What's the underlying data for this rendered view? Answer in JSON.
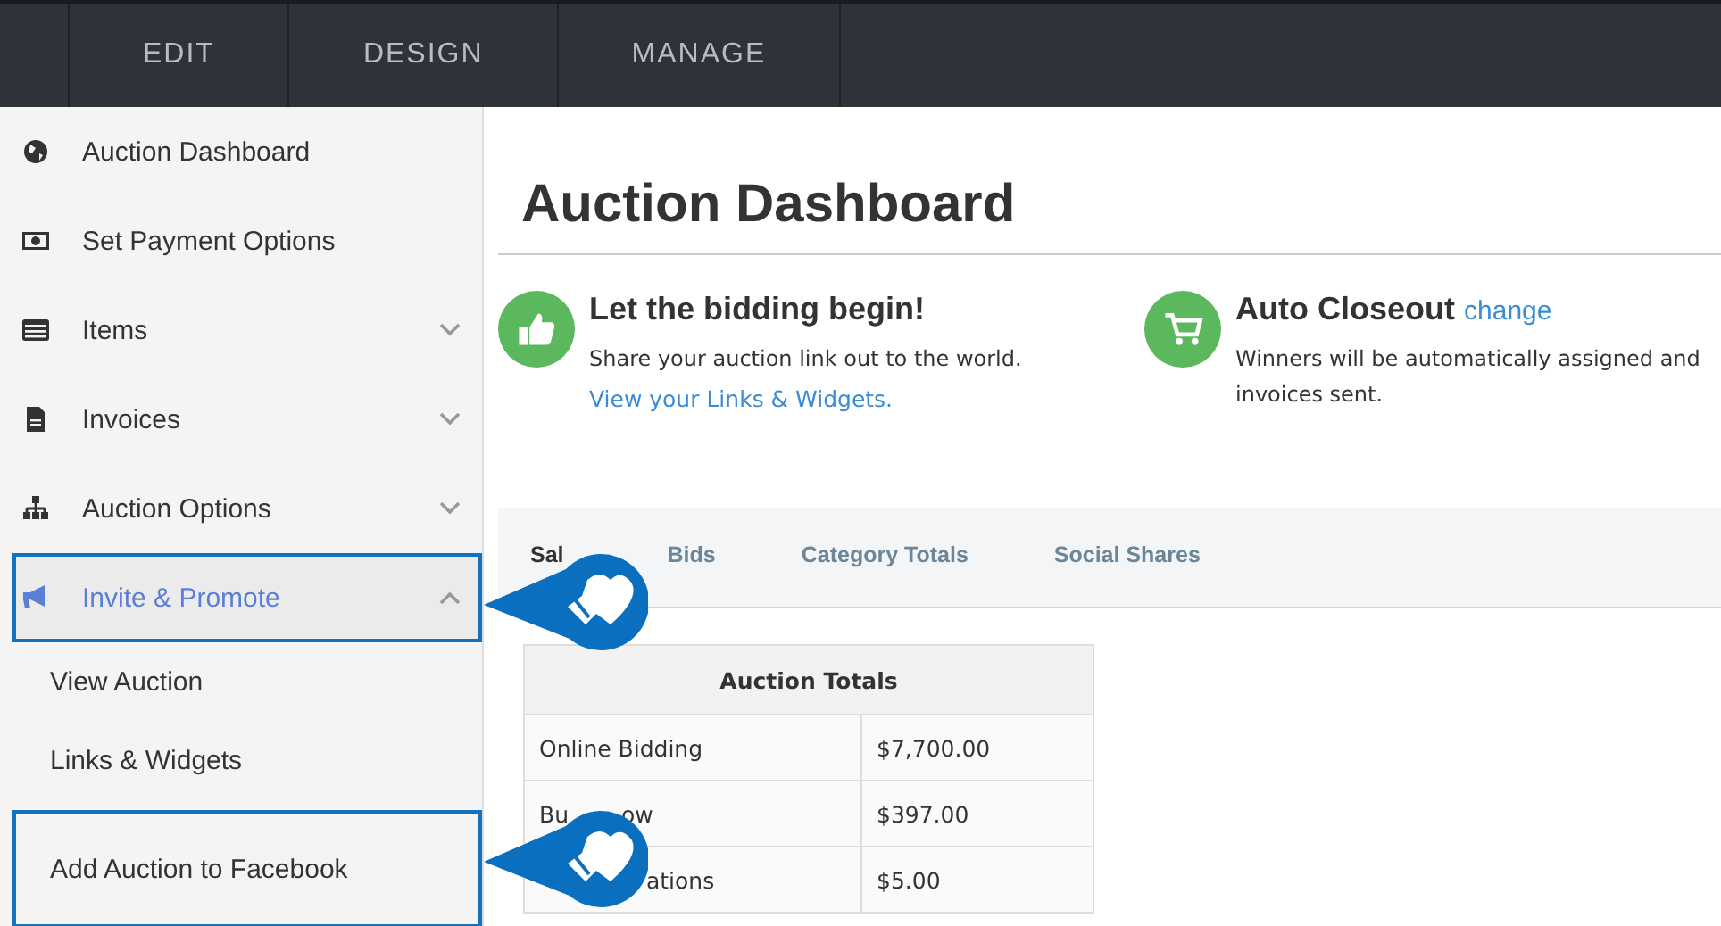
{
  "top_tabs": [
    {
      "label": "EDIT"
    },
    {
      "label": "DESIGN"
    },
    {
      "label": "MANAGE"
    }
  ],
  "sidebar": {
    "items": [
      {
        "label": "Auction Dashboard",
        "selected": false,
        "highlighted": false
      },
      {
        "label": "Set Payment Options",
        "selected": false,
        "highlighted": false
      },
      {
        "label": "Items",
        "expanded": false,
        "selected": false,
        "highlighted": false
      },
      {
        "label": "Invoices",
        "expanded": false,
        "selected": false,
        "highlighted": false
      },
      {
        "label": "Auction Options",
        "expanded": false,
        "selected": false,
        "highlighted": false
      },
      {
        "label": "Invite & Promote",
        "expanded": true,
        "selected": true,
        "highlighted": true,
        "children": [
          {
            "label": "View Auction",
            "highlighted": false
          },
          {
            "label": "Links & Widgets",
            "highlighted": false
          },
          {
            "label": "Add Auction to Facebook",
            "highlighted": true
          }
        ]
      }
    ]
  },
  "page_title": "Auction Dashboard",
  "cards": [
    {
      "title": "Let the bidding begin!",
      "text": "Share your auction link out to the world.",
      "link": "View your Links & Widgets."
    },
    {
      "title": "Auto Closeout",
      "title_link": "change",
      "text": "Winners will be automatically assigned and invoices sent."
    }
  ],
  "tabs": [
    {
      "label": "Sal",
      "selected": true
    },
    {
      "label": "Bids",
      "selected": false
    },
    {
      "label": "Category Totals",
      "selected": false
    },
    {
      "label": "Social Shares",
      "selected": false
    }
  ],
  "table": {
    "title": "Auction Totals",
    "rows": [
      {
        "label_parts": [
          "Online Bidding"
        ],
        "amount": "$7,700.00"
      },
      {
        "label_parts": [
          "Bu",
          "ow"
        ],
        "amount": "$397.00"
      },
      {
        "label_parts": [
          "ations"
        ],
        "amount": "$5.00"
      }
    ]
  }
}
